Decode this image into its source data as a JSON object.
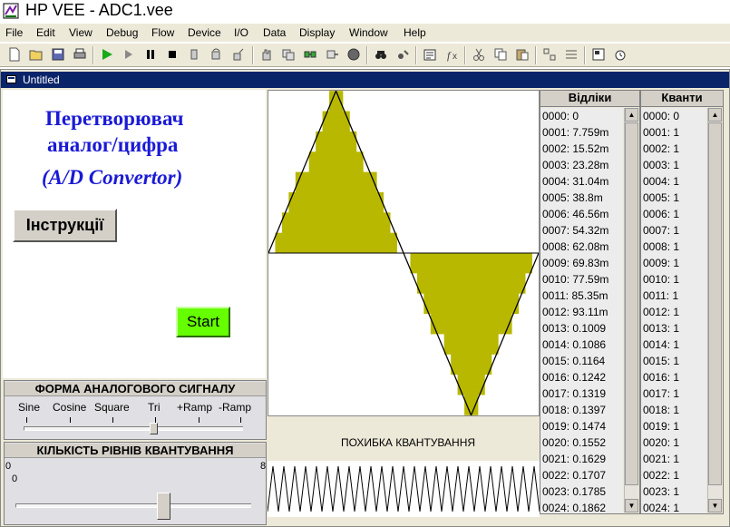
{
  "window": {
    "title": "HP VEE - ADC1.vee"
  },
  "menu": [
    "File",
    "Edit",
    "View",
    "Debug",
    "Flow",
    "Device",
    "I/O",
    "Data",
    "Display",
    "Window",
    "Help"
  ],
  "toolbar": {
    "icons": [
      "new-icon",
      "open-icon",
      "save-icon",
      "print-icon",
      "run-icon",
      "step-icon",
      "pause-icon",
      "stop-icon",
      "step-into-icon",
      "step-over-icon",
      "step-out-icon",
      "hand-icon",
      "copy-object-icon",
      "line-probe-icon",
      "data-flow-icon",
      "globe-icon",
      "find-icon",
      "find-next-icon",
      "properties-icon",
      "function-icon",
      "cut-icon",
      "copy-icon",
      "paste-icon",
      "create-ui-icon",
      "ui-panel-icon",
      "panel-view-icon",
      "timer-icon"
    ]
  },
  "panel": {
    "title": "Untitled"
  },
  "heading": {
    "line1": "Перетворювач",
    "line2": "аналог/цифра",
    "line3": "(A/D Convertor)",
    "color": "#1a1ad6"
  },
  "buttons": {
    "instructions": "Інструкції",
    "start": "Start",
    "start_color": "#66ff00"
  },
  "waveform_slider": {
    "title": "ФОРМА АНАЛОГОВОГО СИГНАЛУ",
    "options": [
      "Sine",
      "Cosine",
      "Square",
      "Tri",
      "+Ramp",
      "-Ramp"
    ],
    "selected": "Tri"
  },
  "levels_slider": {
    "title": "КІЛЬКІСТЬ РІВНІВ КВАНТУВАННЯ",
    "min_label": "0",
    "max_label": "8",
    "min_value": 0,
    "max_value": 8
  },
  "graph": {
    "fill_color": "#b8b800"
  },
  "error_label": "ПОХИБКА КВАНТУВАННЯ",
  "samples_list": {
    "header": "Відліки",
    "rows": [
      "0000: 0",
      "0001: 7.759m",
      "0002: 15.52m",
      "0003: 23.28m",
      "0004: 31.04m",
      "0005: 38.8m",
      "0006: 46.56m",
      "0007: 54.32m",
      "0008: 62.08m",
      "0009: 69.83m",
      "0010: 77.59m",
      "0011: 85.35m",
      "0012: 93.11m",
      "0013: 0.1009",
      "0014: 0.1086",
      "0015: 0.1164",
      "0016: 0.1242",
      "0017: 0.1319",
      "0018: 0.1397",
      "0019: 0.1474",
      "0020: 0.1552",
      "0021: 0.1629",
      "0022: 0.1707",
      "0023: 0.1785",
      "0024: 0.1862"
    ]
  },
  "quanta_list": {
    "header": "Кванти",
    "rows": [
      "0000: 0",
      "0001: 1",
      "0002: 1",
      "0003: 1",
      "0004: 1",
      "0005: 1",
      "0006: 1",
      "0007: 1",
      "0008: 1",
      "0009: 1",
      "0010: 1",
      "0011: 1",
      "0012: 1",
      "0013: 1",
      "0014: 1",
      "0015: 1",
      "0016: 1",
      "0017: 1",
      "0018: 1",
      "0019: 1",
      "0020: 1",
      "0021: 1",
      "0022: 1",
      "0023: 1",
      "0024: 1"
    ]
  }
}
